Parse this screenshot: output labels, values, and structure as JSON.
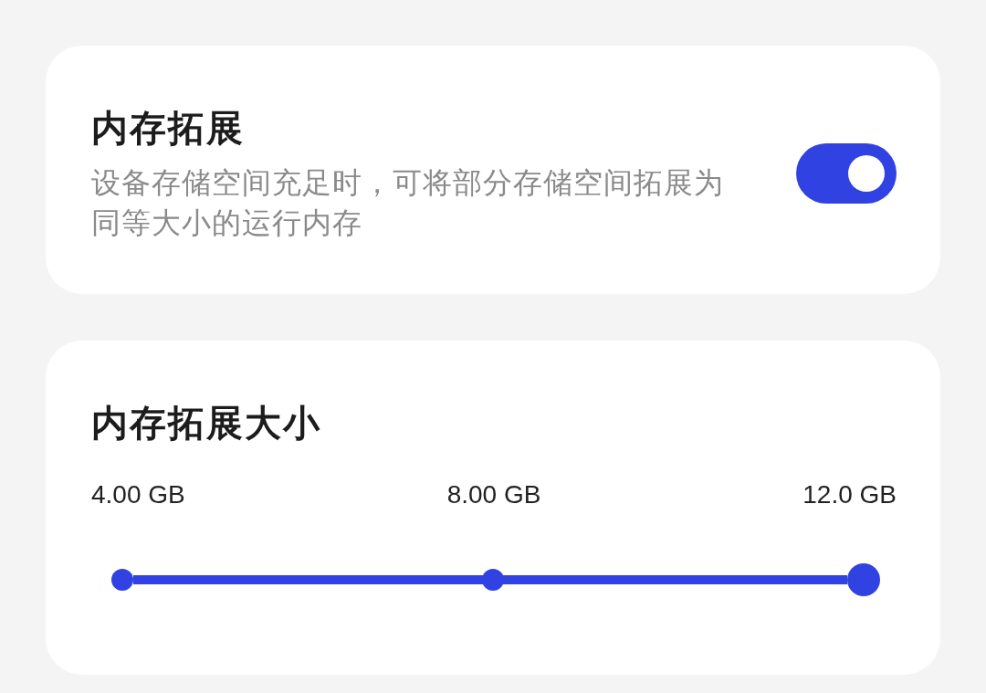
{
  "memory_extension": {
    "title": "内存拓展",
    "description": "设备存储空间充足时，可将部分存储空间拓展为同等大小的运行内存",
    "toggle": {
      "on": true
    }
  },
  "extension_size": {
    "title": "内存拓展大小",
    "slider": {
      "stops": [
        "4.00 GB",
        "8.00 GB",
        "12.0 GB"
      ],
      "level": 1
    }
  }
}
